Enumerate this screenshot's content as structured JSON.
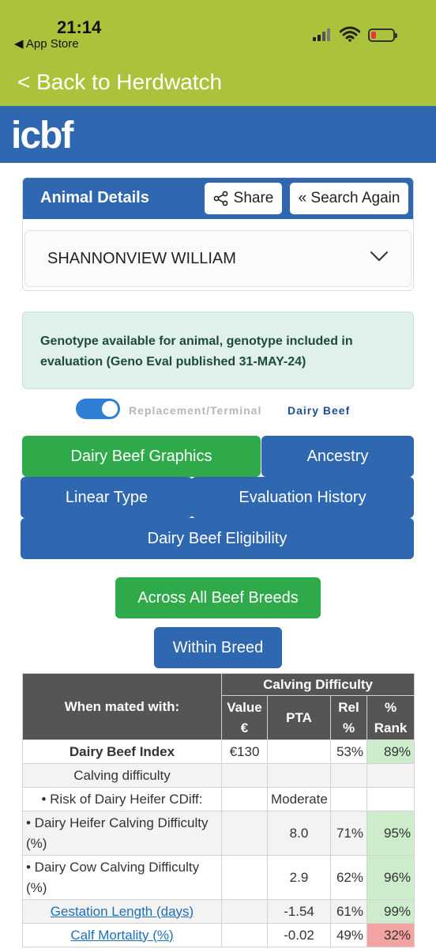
{
  "status_bar": {
    "time": "21:14",
    "back_app": "◀ App Store"
  },
  "back_bar": {
    "label": "< Back to Herdwatch"
  },
  "brand": {
    "logo_text": "icbf"
  },
  "animal_details": {
    "title": "Animal Details",
    "share_label": "Share",
    "search_again_label": "« Search Again",
    "selected_animal": "SHANNONVIEW WILLIAM"
  },
  "genotype_alert": {
    "message": "Genotype available for animal, genotype included in evaluation (Geno Eval published 31-MAY-24)"
  },
  "toggle": {
    "left_label": "Replacement/Terminal",
    "right_label": "Dairy Beef",
    "state": "on"
  },
  "tabs": {
    "dairy_beef_graphics": "Dairy Beef Graphics",
    "ancestry": "Ancestry",
    "linear_type": "Linear Type",
    "evaluation_history": "Evaluation History",
    "dairy_beef_eligibility": "Dairy Beef Eligibility"
  },
  "filters": {
    "across_all": "Across All Beef Breeds",
    "within_breed": "Within Breed"
  },
  "table": {
    "group_header": "Calving Difficulty",
    "col_mated": "When mated with:",
    "col_value_1": "Value",
    "col_value_2": "€",
    "col_pta": "PTA",
    "col_rel_1": "Rel",
    "col_rel_2": "%",
    "col_rank_1": "%",
    "col_rank_2": "Rank",
    "rows": [
      {
        "label": "Dairy Beef Index",
        "value": "€130",
        "pta": "",
        "rel": "53%",
        "rank": "89%"
      },
      {
        "label": "Calving difficulty",
        "value": "",
        "pta": "",
        "rel": "",
        "rank": ""
      },
      {
        "label": "• Risk of Dairy Heifer CDiff:",
        "value": "",
        "pta": "Moderate",
        "rel": "",
        "rank": ""
      },
      {
        "label": "• Dairy Heifer Calving Difficulty (%)",
        "value": "",
        "pta": "8.0",
        "rel": "71%",
        "rank": "95%"
      },
      {
        "label": "• Dairy Cow Calving Difficulty (%)",
        "value": "",
        "pta": "2.9",
        "rel": "62%",
        "rank": "96%"
      },
      {
        "label": "Gestation Length (days)",
        "value": "",
        "pta": "-1.54",
        "rel": "61%",
        "rank": "99%"
      },
      {
        "label": "Calf Mortality (%)",
        "value": "",
        "pta": "-0.02",
        "rel": "49%",
        "rank": "32%"
      }
    ]
  }
}
